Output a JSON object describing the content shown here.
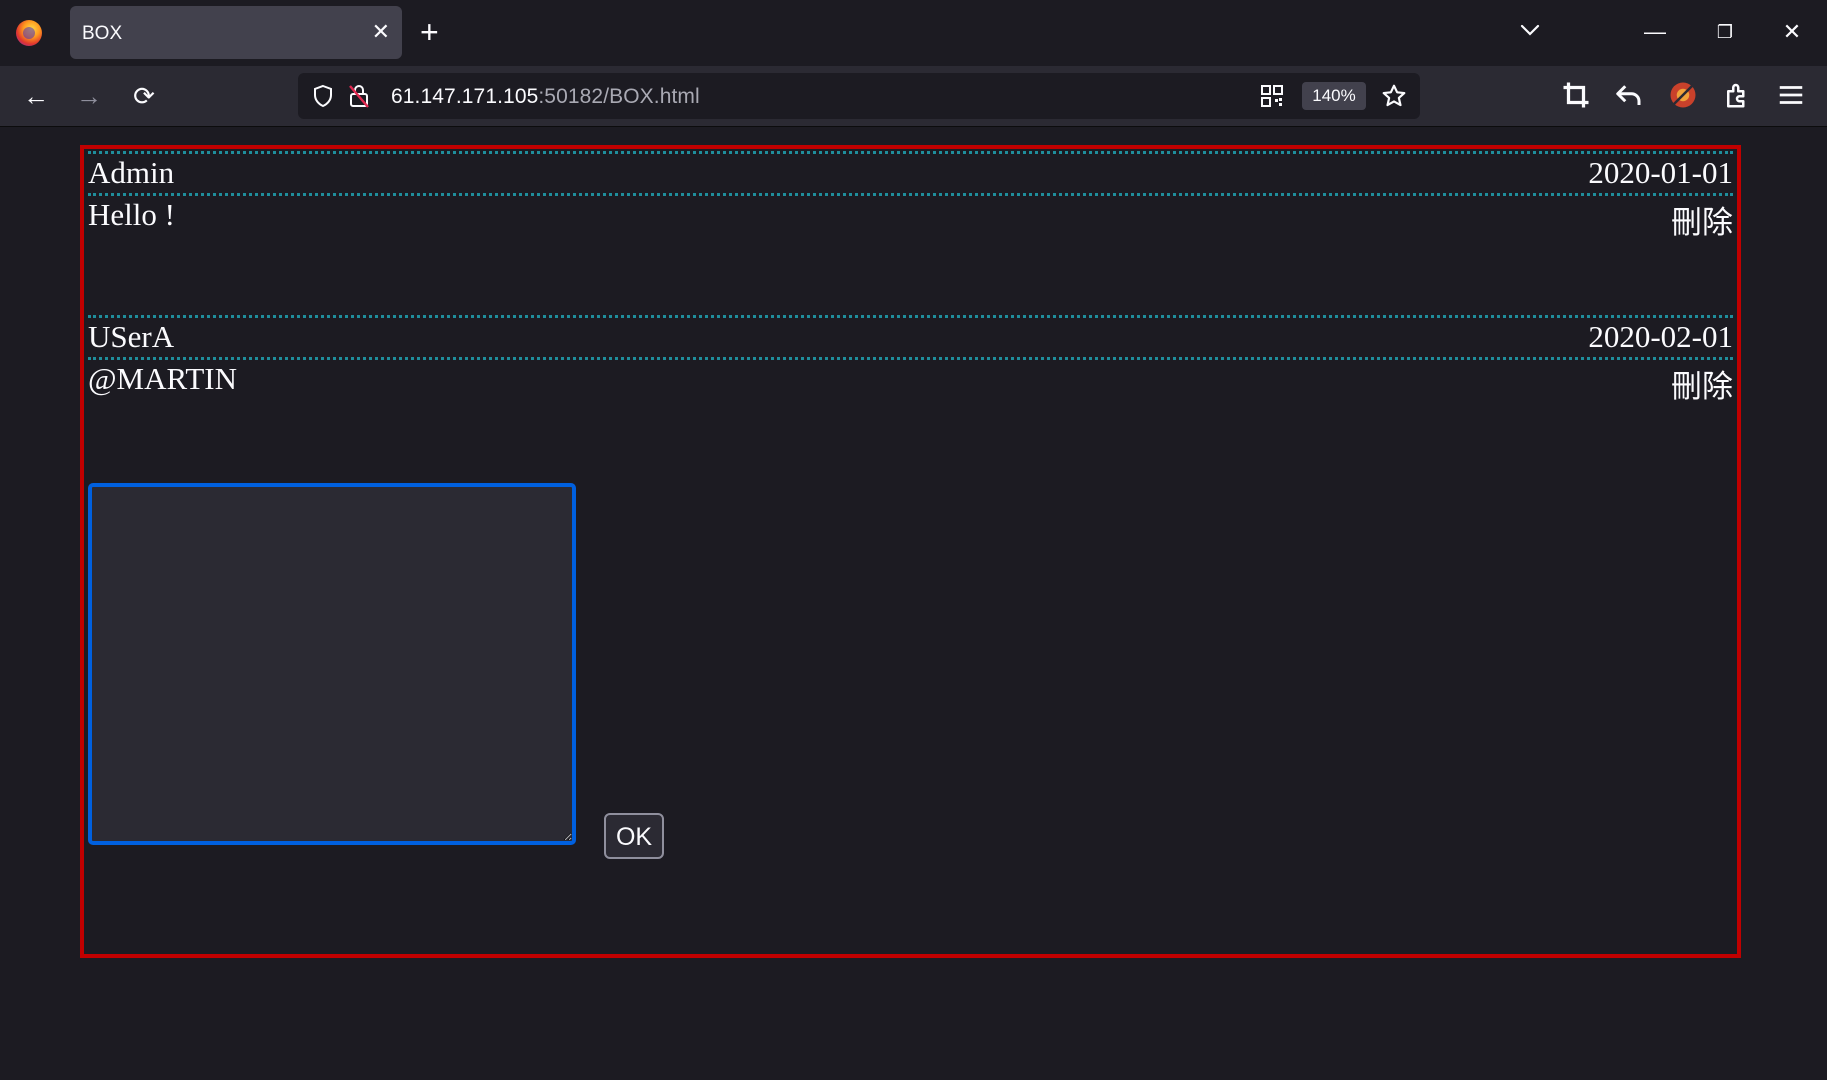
{
  "browser": {
    "tab_title": "BOX",
    "tab_close": "✕",
    "new_tab": "+",
    "url_host": "61.147.171.105",
    "url_rest": ":50182/BOX.html",
    "zoom": "140%",
    "window_controls": {
      "minimize": "—",
      "restore": "❐",
      "close": "✕"
    },
    "nav": {
      "back": "←",
      "forward": "→",
      "reload": "⟳"
    }
  },
  "messages": [
    {
      "user": "Admin",
      "date": "2020-01-01",
      "body": "Hello !",
      "delete_label": "刪除"
    },
    {
      "user": "USerA",
      "date": "2020-02-01",
      "body": "@MARTIN",
      "delete_label": "刪除"
    }
  ],
  "reply": {
    "value": "",
    "submit_label": "OK"
  },
  "colors": {
    "box_border": "#c00000",
    "divider": "#1f8e9c",
    "textarea_focus": "#0060df",
    "page_bg": "#1c1b22"
  }
}
